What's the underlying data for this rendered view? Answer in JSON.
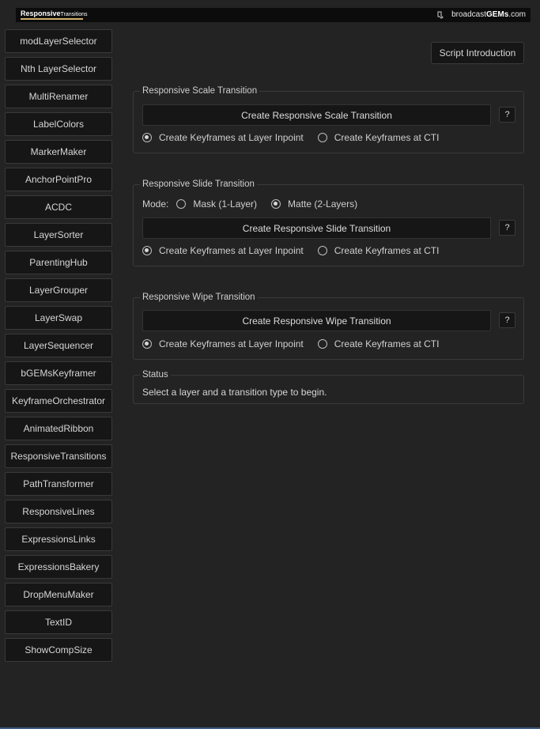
{
  "header": {
    "logo_bold": "Responsive",
    "logo_thin": "Transitions",
    "brand_prefix": "broadcast",
    "brand_bold": "GEMs",
    "brand_suffix": ".com"
  },
  "sidebar": {
    "items": [
      "modLayerSelector",
      "Nth LayerSelector",
      "MultiRenamer",
      "LabelColors",
      "MarkerMaker",
      "AnchorPointPro",
      "ACDC",
      "LayerSorter",
      "ParentingHub",
      "LayerGrouper",
      "LayerSwap",
      "LayerSequencer",
      "bGEMsKeyframer",
      "KeyframeOrchestrator",
      "AnimatedRibbon",
      "ResponsiveTransitions",
      "PathTransformer",
      "ResponsiveLines",
      "ExpressionsLinks",
      "ExpressionsBakery",
      "DropMenuMaker",
      "TextID",
      "ShowCompSize"
    ]
  },
  "intro_button": "Script Introduction",
  "scale": {
    "title": "Responsive Scale Transition",
    "button": "Create Responsive Scale Transition",
    "help": "?",
    "opt_inpoint": "Create Keyframes at Layer Inpoint",
    "opt_cti": "Create Keyframes at CTI",
    "selected": "inpoint"
  },
  "slide": {
    "title": "Responsive Slide Transition",
    "mode_label": "Mode:",
    "mode_mask": "Mask (1-Layer)",
    "mode_matte": "Matte (2-Layers)",
    "mode_selected": "matte",
    "button": "Create Responsive Slide Transition",
    "help": "?",
    "opt_inpoint": "Create Keyframes at Layer Inpoint",
    "opt_cti": "Create Keyframes at CTI",
    "selected": "inpoint"
  },
  "wipe": {
    "title": "Responsive Wipe Transition",
    "button": "Create Responsive Wipe Transition",
    "help": "?",
    "opt_inpoint": "Create Keyframes at Layer Inpoint",
    "opt_cti": "Create Keyframes at CTI",
    "selected": "inpoint"
  },
  "status": {
    "title": "Status",
    "message": "Select a layer and a transition type to begin."
  }
}
